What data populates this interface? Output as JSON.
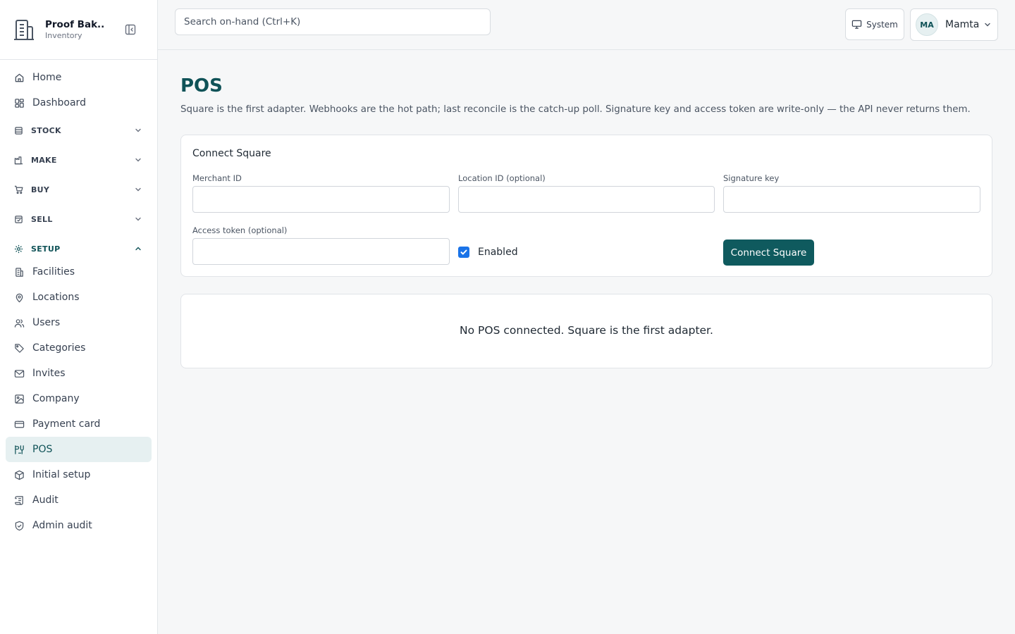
{
  "brand": {
    "name": "Proof Bak...",
    "subtitle": "Inventory"
  },
  "search": {
    "placeholder": "Search on-hand (Ctrl+K)"
  },
  "theme": {
    "label": "System"
  },
  "user": {
    "initials": "MA",
    "name": "Mamta"
  },
  "nav": {
    "home": "Home",
    "dashboard": "Dashboard",
    "groups": {
      "stock": "STOCK",
      "make": "MAKE",
      "buy": "BUY",
      "sell": "SELL",
      "setup": "SETUP"
    },
    "setup_items": {
      "facilities": "Facilities",
      "locations": "Locations",
      "users": "Users",
      "categories": "Categories",
      "invites": "Invites",
      "company": "Company",
      "payment_card": "Payment card",
      "pos": "POS",
      "initial_setup": "Initial setup",
      "audit": "Audit",
      "admin_audit": "Admin audit"
    },
    "active": "POS"
  },
  "page": {
    "title": "POS",
    "description": "Square is the first adapter. Webhooks are the hot path; last reconcile is the catch-up poll. Signature key and access token are write-only — the API never returns them."
  },
  "connect": {
    "title": "Connect Square",
    "merchant_id_label": "Merchant ID",
    "location_id_label": "Location ID (optional)",
    "signature_key_label": "Signature key",
    "access_token_label": "Access token (optional)",
    "enabled_label": "Enabled",
    "enabled": true,
    "submit_label": "Connect Square"
  },
  "empty_state": {
    "message": "No POS connected. Square is the first adapter."
  },
  "colors": {
    "accent": "#0f5257",
    "button": "#0f5a5e",
    "checkbox": "#1a73e8",
    "active_bg": "#e6f0f1"
  }
}
